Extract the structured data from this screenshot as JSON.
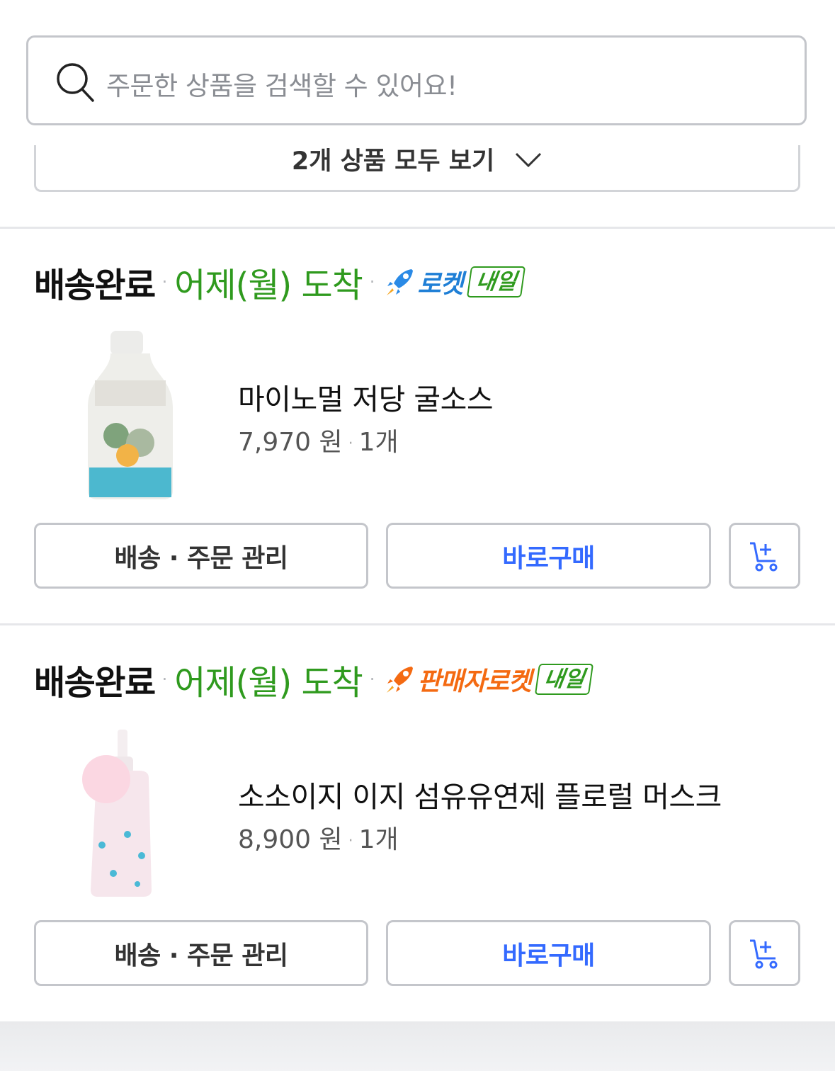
{
  "search": {
    "placeholder": "주문한 상품을 검색할 수 있어요!"
  },
  "view_all": {
    "label": "2개 상품 모두 보기"
  },
  "orders": [
    {
      "status": "배송완료",
      "arrival": "어제(월) 도착",
      "delivery_type": "로켓",
      "delivery_color": "#1f7fd6",
      "badge": "내일",
      "product_name": "마이노멀 저당 굴소스",
      "price": "7,970 원",
      "quantity": "1개",
      "manage_label": "배송 · 주문 관리",
      "buy_label": "바로구매"
    },
    {
      "status": "배송완료",
      "arrival": "어제(월) 도착",
      "delivery_type": "판매자로켓",
      "delivery_color": "#f46a12",
      "badge": "내일",
      "product_name": "소소이지 이지 섬유유연제 플로럴 머스크",
      "price": "8,900 원",
      "quantity": "1개",
      "manage_label": "배송 · 주문 관리",
      "buy_label": "바로구매"
    }
  ],
  "colors": {
    "arrival": "#2f9a1e",
    "buy": "#346aff"
  }
}
